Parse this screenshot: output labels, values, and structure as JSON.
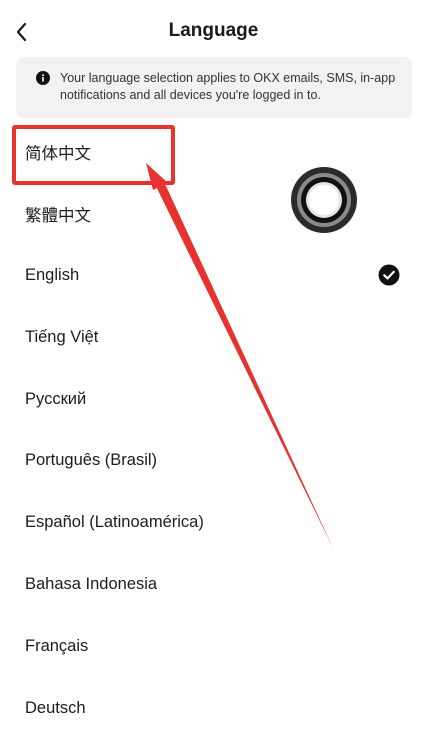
{
  "header": {
    "title": "Language"
  },
  "banner": {
    "text": "Your language selection applies to OKX emails, SMS, in-app notifications and all devices you're logged in to."
  },
  "languages": [
    {
      "label": "简体中文",
      "selected": false
    },
    {
      "label": "繁體中文",
      "selected": false
    },
    {
      "label": "English",
      "selected": true
    },
    {
      "label": "Tiếng Việt",
      "selected": false
    },
    {
      "label": "Русский",
      "selected": false
    },
    {
      "label": "Português (Brasil)",
      "selected": false
    },
    {
      "label": "Español (Latinoamérica)",
      "selected": false
    },
    {
      "label": "Bahasa Indonesia",
      "selected": false
    },
    {
      "label": "Français",
      "selected": false
    },
    {
      "label": "Deutsch",
      "selected": false
    }
  ],
  "colors": {
    "annotation": "#e8322f",
    "banner_bg": "#f2f2f4",
    "text": "#1c1c1c"
  },
  "icons": {
    "back": "chevron-left-icon",
    "info": "info-icon",
    "check": "check-circle-icon",
    "loader": "loading-ring-icon"
  }
}
